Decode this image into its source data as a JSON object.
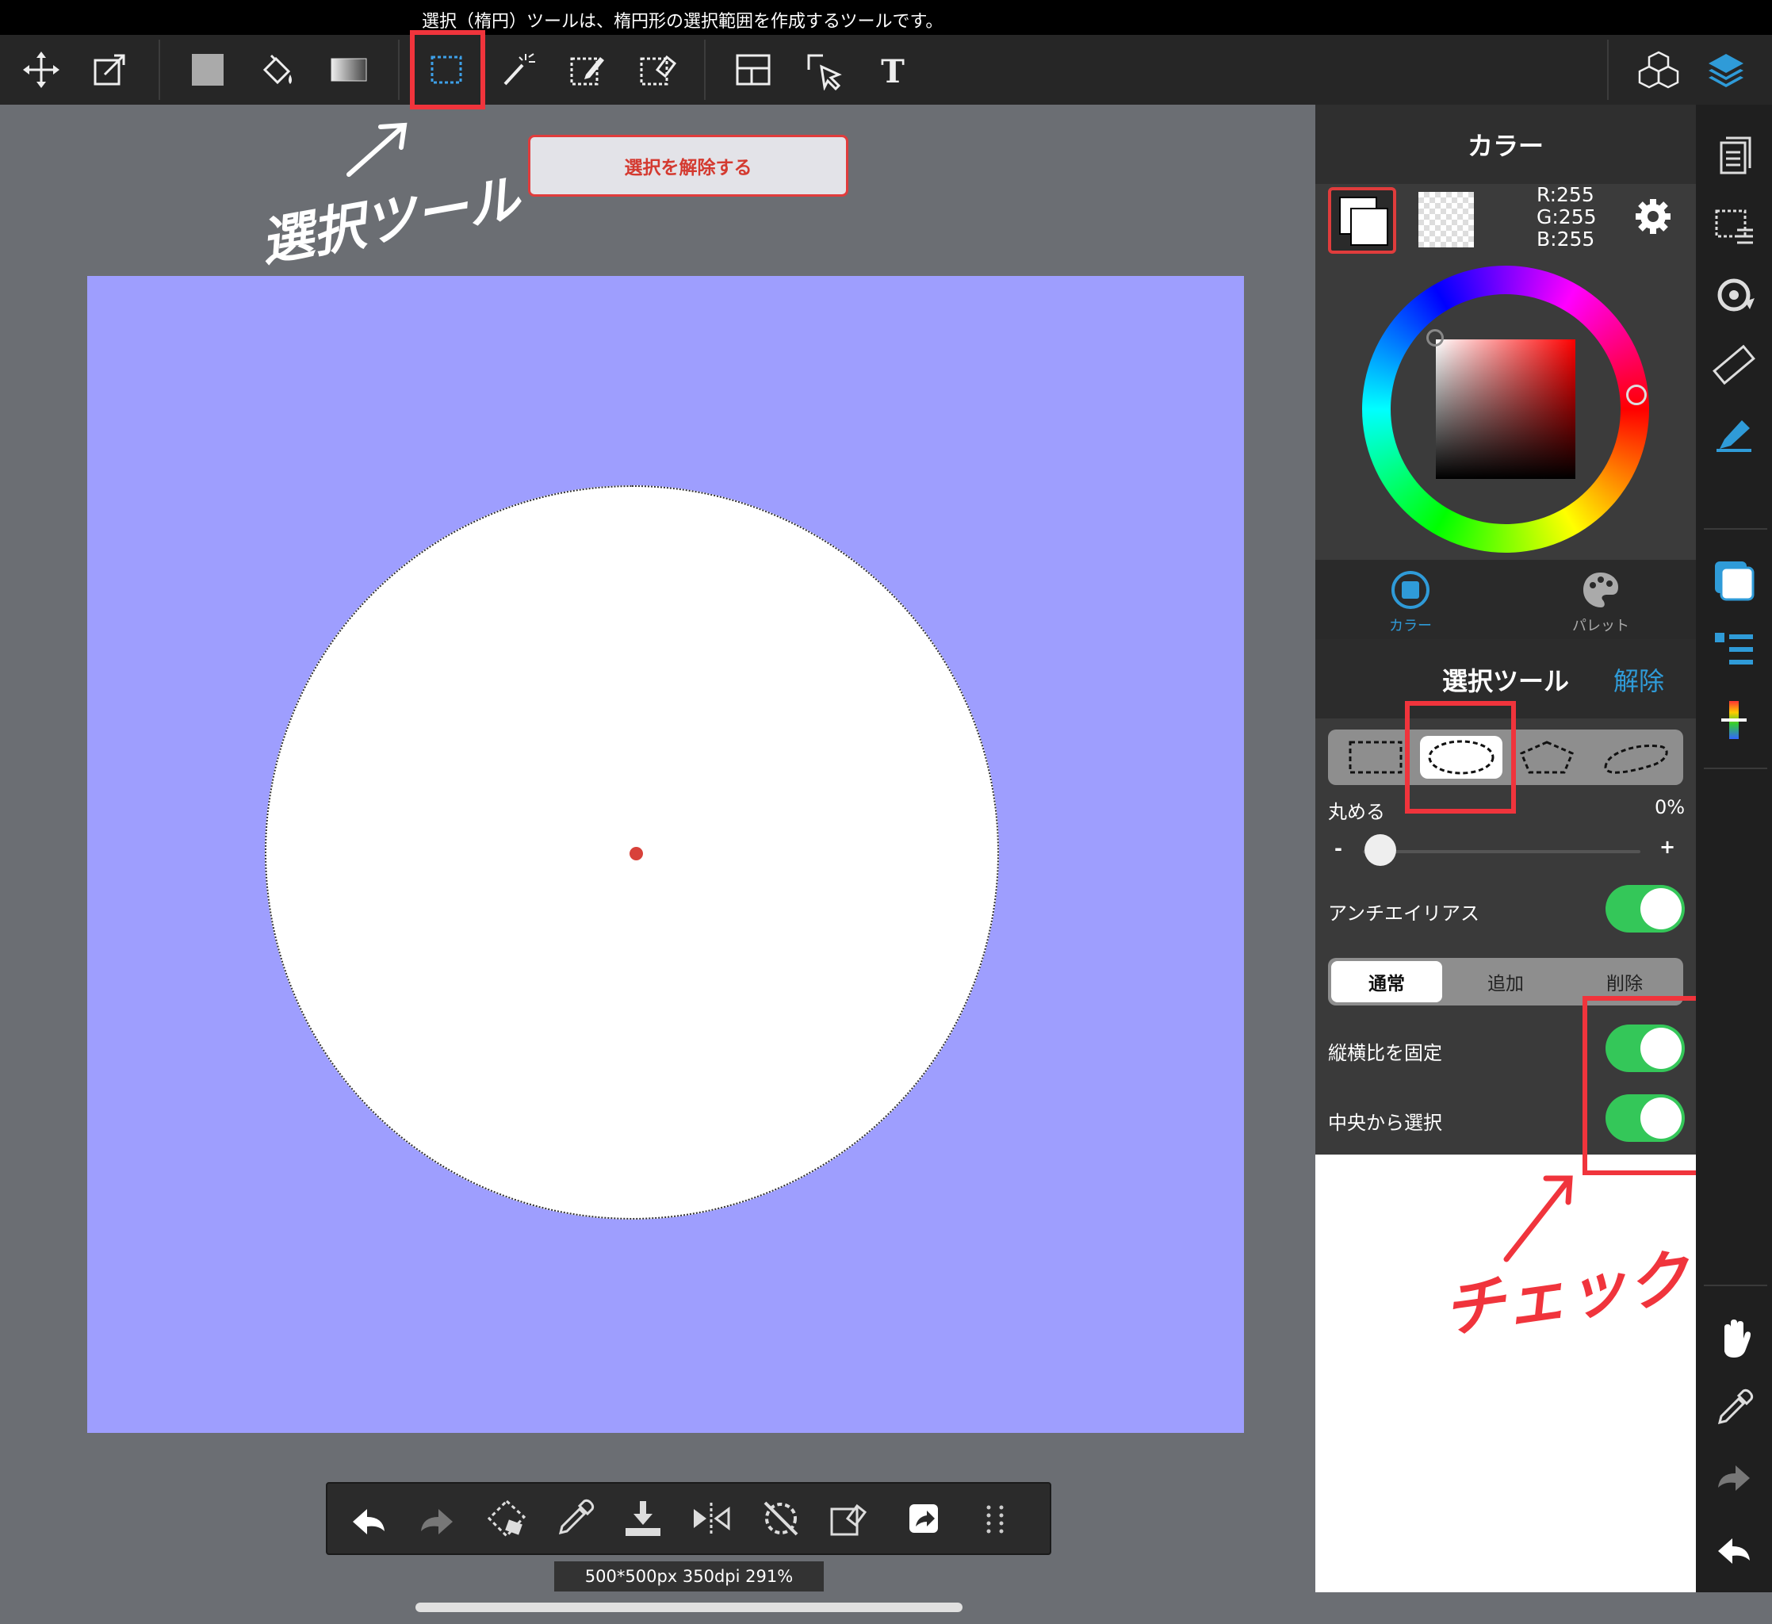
{
  "tooltip": "選択（楕円）ツールは、楕円形の選択範囲を作成するツールです。",
  "toolbar": {
    "tools": [
      "move-icon",
      "transform-icon",
      "fill-rect-icon",
      "bucket-icon",
      "gradient-icon",
      "select-rect-icon",
      "magic-wand-icon",
      "select-pen-icon",
      "select-eraser-icon",
      "frame-divide-icon",
      "operation-icon",
      "text-icon"
    ],
    "right": [
      "materials-icon",
      "layers-icon"
    ]
  },
  "deselect_button": "選択を解除する",
  "annotation_select_tool": "選択ツール",
  "annotation_check": "チェック",
  "color_panel": {
    "title": "カラー",
    "rgb": {
      "r": "R:255",
      "g": "G:255",
      "b": "B:255"
    },
    "tab_color": "カラー",
    "tab_palette": "パレット",
    "main_color": "#ffffff"
  },
  "select_panel": {
    "title": "選択ツール",
    "clear": "解除",
    "shapes": [
      "rectangle",
      "ellipse",
      "polygon",
      "lasso"
    ],
    "active_shape": "ellipse",
    "round_label": "丸める",
    "round_value": "0%",
    "minus": "-",
    "plus": "+",
    "round_fraction": 0,
    "antialias_label": "アンチエイリアス",
    "antialias_on": true,
    "modes": [
      "通常",
      "追加",
      "削除"
    ],
    "active_mode": "通常",
    "fix_ratio_label": "縦横比を固定",
    "fix_ratio_on": true,
    "from_center_label": "中央から選択",
    "from_center_on": true
  },
  "status": "500*500px 350dpi 291%",
  "colors": {
    "accent": "#2f9bd8",
    "red": "#f0343c",
    "toggle_on": "#34c759",
    "canvas_bg": "#9e9efe"
  }
}
